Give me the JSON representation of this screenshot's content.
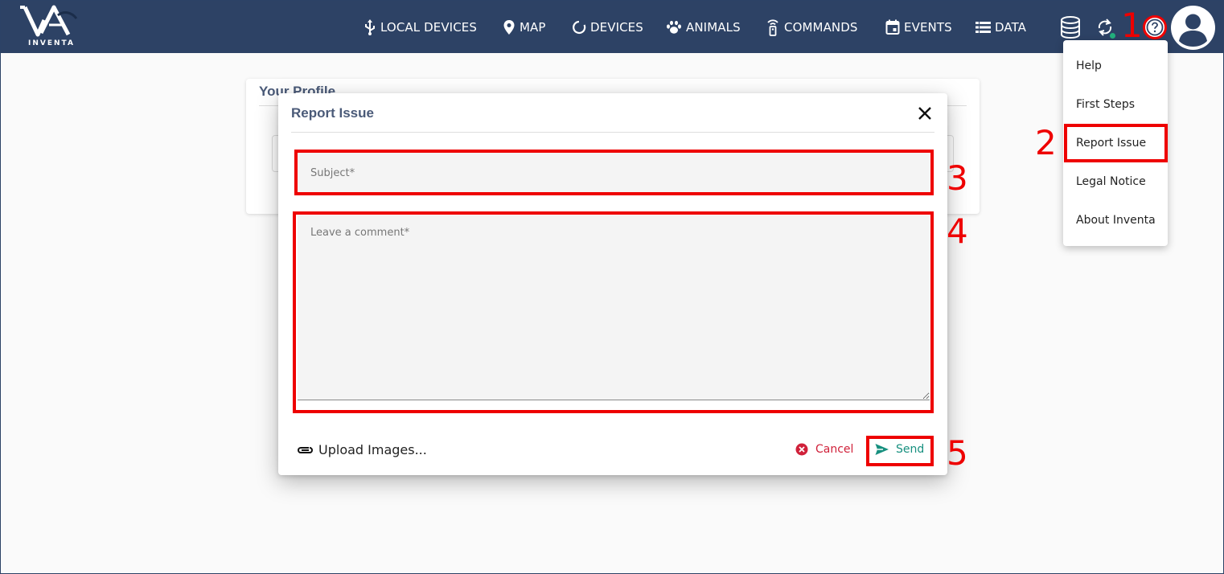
{
  "app": {
    "logo_text": "INVENTA"
  },
  "nav": {
    "items": [
      {
        "label": "LOCAL DEVICES",
        "icon": "usb-icon"
      },
      {
        "label": "MAP",
        "icon": "map-pin-icon"
      },
      {
        "label": "DEVICES",
        "icon": "circle-loader-icon"
      },
      {
        "label": "ANIMALS",
        "icon": "paw-icon"
      },
      {
        "label": "COMMANDS",
        "icon": "remote-icon"
      },
      {
        "label": "EVENTS",
        "icon": "calendar-icon"
      },
      {
        "label": "DATA",
        "icon": "list-icon"
      }
    ],
    "actions": [
      "database-icon",
      "sync-icon",
      "help-icon",
      "account-icon"
    ]
  },
  "profile_card": {
    "title": "Your Profile"
  },
  "dialog": {
    "title": "Report Issue",
    "subject_placeholder": "Subject*",
    "comment_placeholder": "Leave a comment*",
    "upload_label": "Upload Images...",
    "cancel_label": "Cancel",
    "send_label": "Send"
  },
  "help_menu": {
    "items": [
      "Help",
      "First Steps",
      "Report Issue",
      "Legal Notice",
      "About Inventa"
    ]
  },
  "annotations": {
    "step1": "1",
    "step2": "2",
    "step3": "3",
    "step4": "4",
    "step5": "5"
  },
  "colors": {
    "topbar": "#2d4265",
    "annotation": "#ee0000",
    "cancel": "#d0213a",
    "send": "#17907f",
    "title": "#4a5a78"
  }
}
